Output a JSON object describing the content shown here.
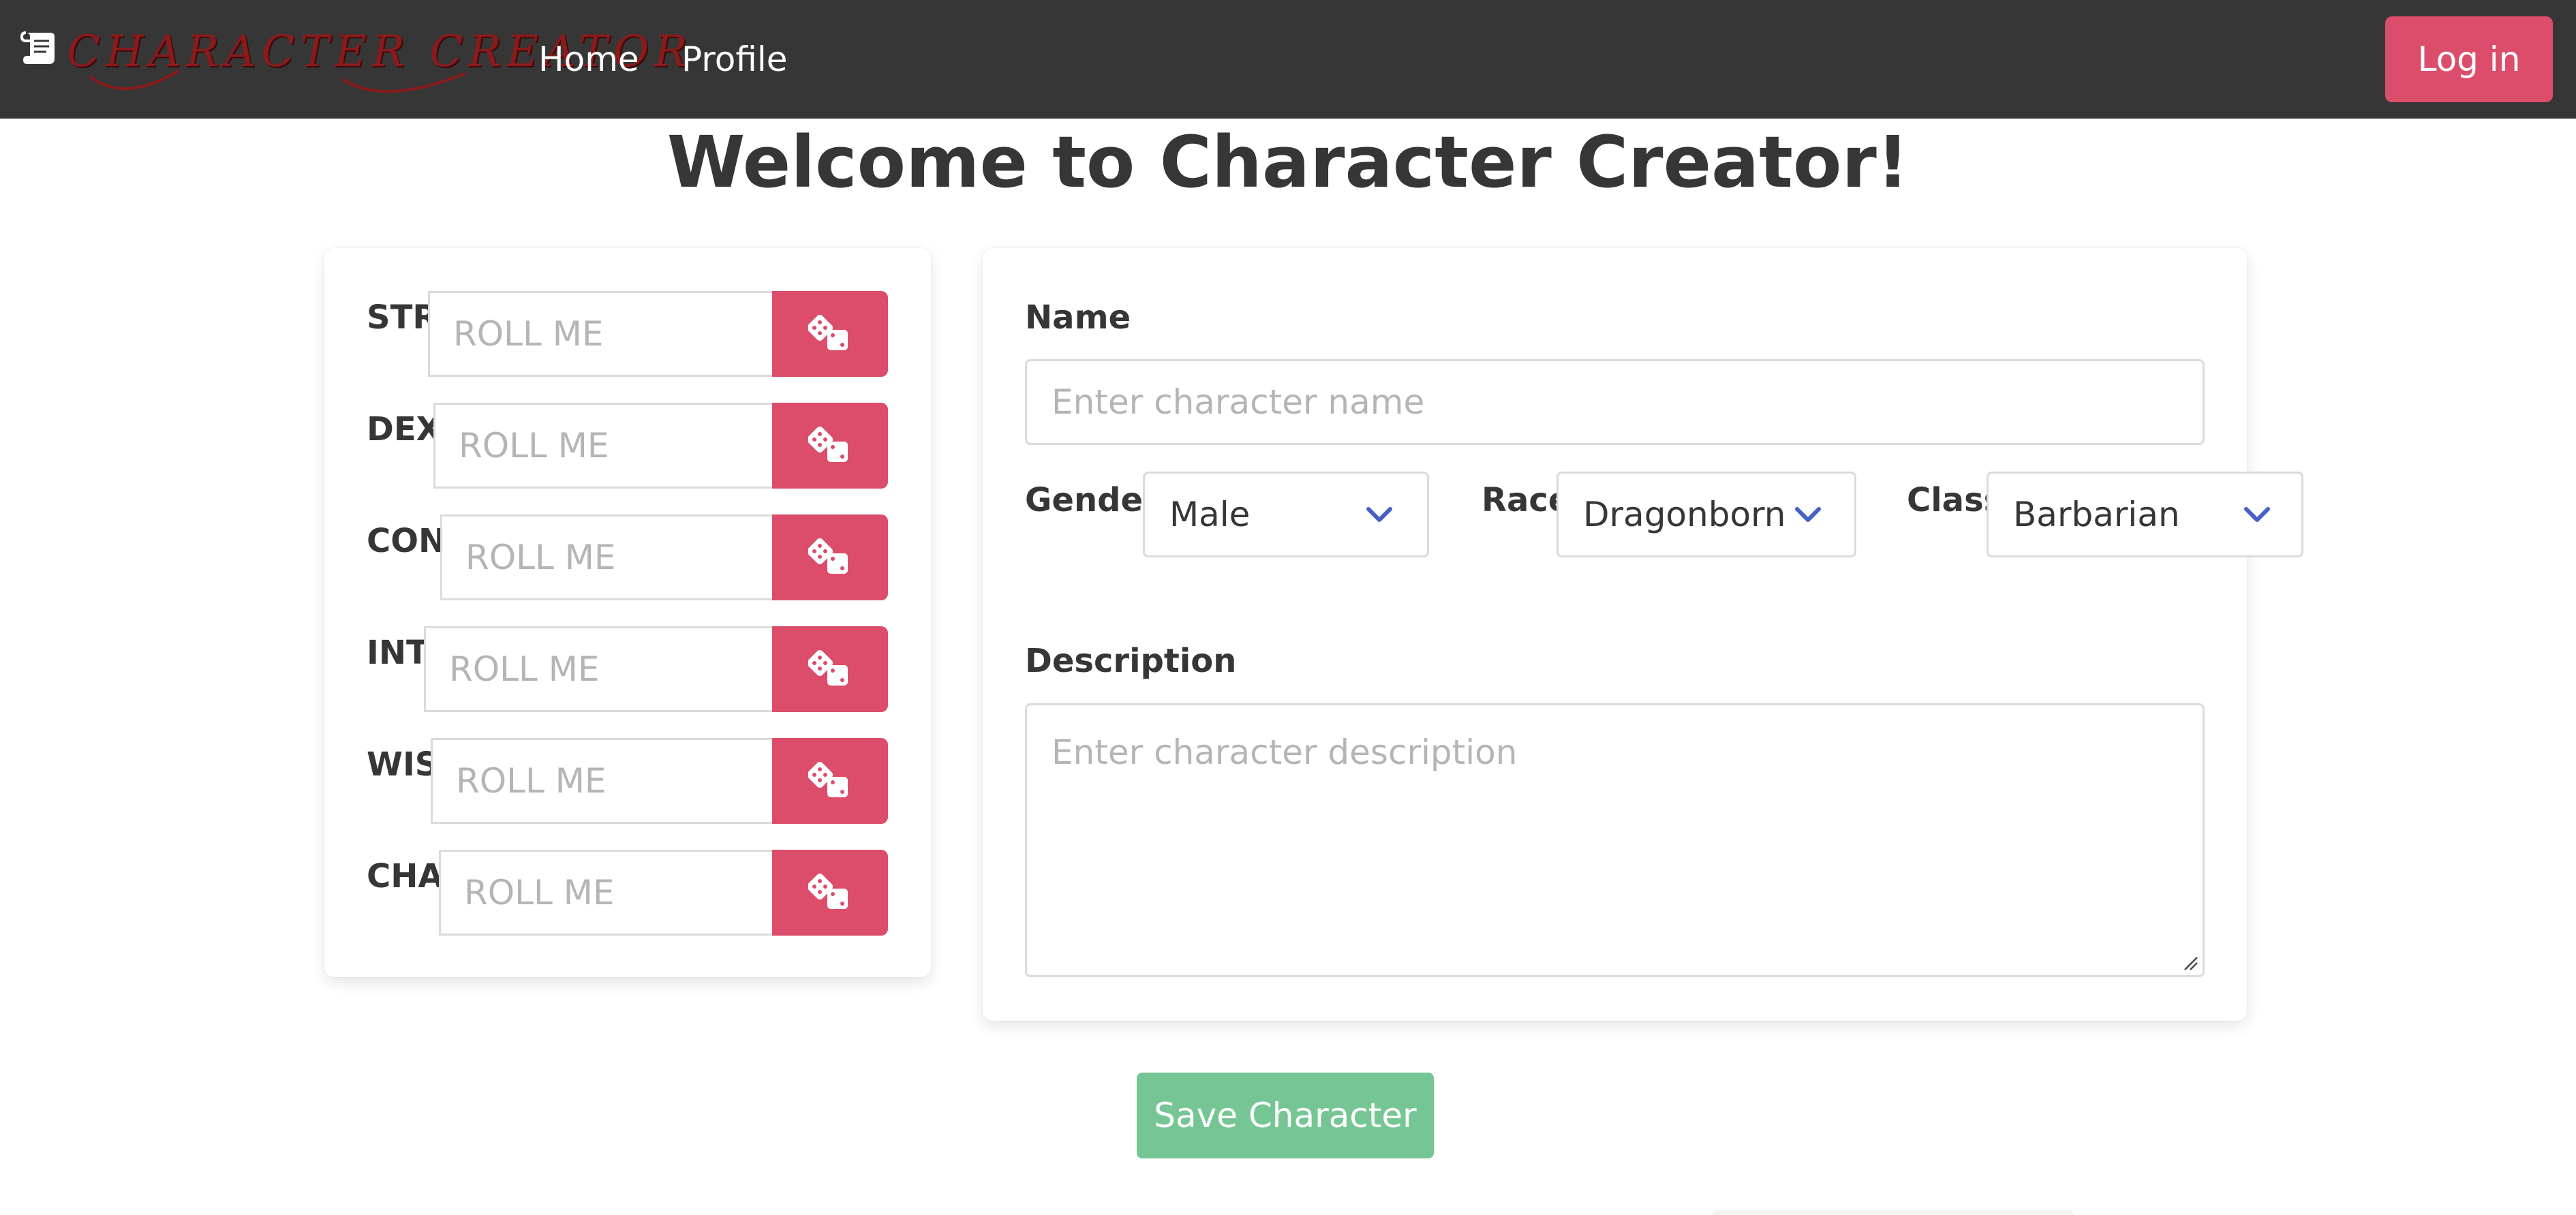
{
  "navbar": {
    "logo_text": "CHARACTER CREATOR",
    "links": [
      "Home",
      "Profile"
    ],
    "login_label": "Log in"
  },
  "page": {
    "title": "Welcome to Character Creator!"
  },
  "stats": [
    {
      "label": "STR",
      "placeholder": "ROLL ME"
    },
    {
      "label": "DEX",
      "placeholder": "ROLL ME"
    },
    {
      "label": "CON",
      "placeholder": "ROLL ME"
    },
    {
      "label": "INT",
      "placeholder": "ROLL ME"
    },
    {
      "label": "WIS",
      "placeholder": "ROLL ME"
    },
    {
      "label": "CHA",
      "placeholder": "ROLL ME"
    }
  ],
  "form": {
    "name_label": "Name",
    "name_placeholder": "Enter character name",
    "gender_label": "Gender",
    "gender_value": "Male",
    "race_label": "Race",
    "race_value": "Dragonborn",
    "class_label": "Class",
    "class_value": "Barbarian",
    "description_label": "Description",
    "description_placeholder": "Enter character description"
  },
  "actions": {
    "save_label": "Save Character"
  },
  "colors": {
    "navbar_bg": "#363636",
    "primary": "#dc4d6b",
    "success": "#75c694",
    "chevron": "#485fc7",
    "logo": "#8b1a1a"
  },
  "icons": {
    "logo": "scroll-icon",
    "roll": "dice-icon",
    "select": "chevron-down-icon"
  }
}
